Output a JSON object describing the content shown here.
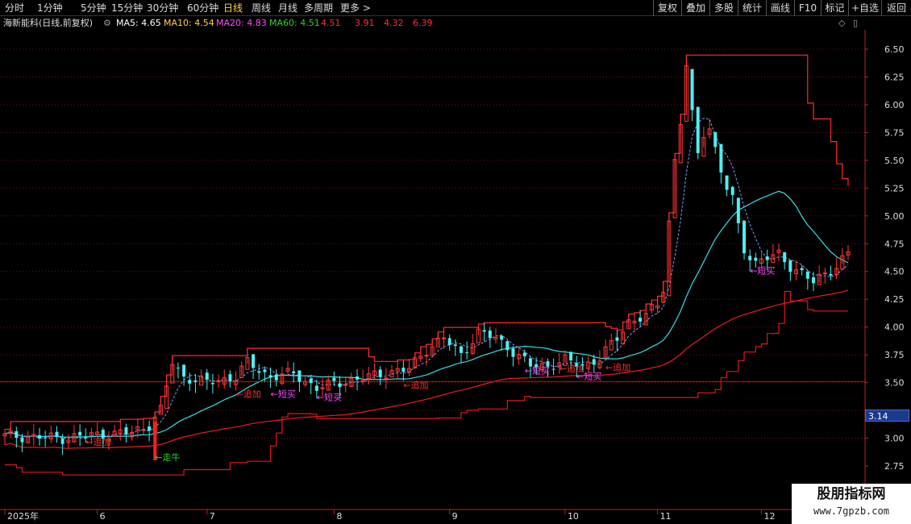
{
  "toolbar": {
    "tabs": [
      "分时",
      "1分钟",
      "5分钟",
      "15分钟",
      "30分钟",
      "60分钟",
      "日线",
      "周线",
      "月线",
      "多周期",
      "更多 >"
    ],
    "active_tab": "日线",
    "right_buttons": [
      "复权",
      "叠加",
      "多股",
      "统计",
      "画线",
      "F10",
      "标记",
      "+自选",
      "返回"
    ]
  },
  "info": {
    "title": "海新能科(日线,前复权)",
    "ma5": "MA5: 4.65",
    "ma10": "MA10: 4.54",
    "ma20": "MA20: 4.83",
    "ma60": "MA60: 4.51",
    "v1": "4.51",
    "v2": "3.91",
    "v3": "4.32",
    "v4": "6.39",
    "colors": {
      "ma5": "#ffffff",
      "ma10": "#ffd24a",
      "ma20": "#ff4cff",
      "ma60": "#2ad42a",
      "red": "#ff3030"
    }
  },
  "price_tag": "3.14",
  "watermark": {
    "title": "股朋指标网",
    "url": "www.7gpzb.com"
  },
  "chart_data": {
    "type": "candlestick",
    "y_ticks": [
      6.5,
      6.25,
      6.0,
      5.75,
      5.5,
      5.25,
      5.0,
      4.75,
      4.5,
      4.25,
      4.0,
      3.75,
      3.5,
      3.25,
      3.0,
      2.75
    ],
    "y_tick_labels": [
      "6.50",
      "6.25",
      "6.00",
      "5.75",
      "5.50",
      "5.25",
      "5.00",
      "4.75",
      "4.50",
      "4.25",
      "4.00",
      "3.75",
      "3.50",
      "",
      "3.00",
      "2.75"
    ],
    "ylim": [
      2.55,
      6.65
    ],
    "x_labels": [
      {
        "label": "2025年",
        "day": 0
      },
      {
        "label": "6",
        "day": 16
      },
      {
        "label": "7",
        "day": 35
      },
      {
        "label": "8",
        "day": 57
      },
      {
        "label": "9",
        "day": 77
      },
      {
        "label": "10",
        "day": 97
      },
      {
        "label": "11",
        "day": 113
      },
      {
        "label": "12",
        "day": 131
      }
    ],
    "day_count": 147,
    "annotations": [
      {
        "text": "←追加",
        "day": 14,
        "price": 2.94,
        "color": "#ff3030"
      },
      {
        "text": "←走牛",
        "day": 26,
        "price": 2.8,
        "color": "#2ad42a"
      },
      {
        "text": "←追加",
        "day": 40,
        "price": 3.37,
        "color": "#ff3030"
      },
      {
        "text": "←短买",
        "day": 46,
        "price": 3.37,
        "color": "#ff4cff"
      },
      {
        "text": "←短买",
        "day": 54,
        "price": 3.34,
        "color": "#ff4cff"
      },
      {
        "text": "←追加",
        "day": 69,
        "price": 3.45,
        "color": "#ff3030"
      },
      {
        "text": "←短买",
        "day": 90,
        "price": 3.58,
        "color": "#ff4cff"
      },
      {
        "text": "←追加",
        "day": 96,
        "price": 3.6,
        "color": "#ff3030"
      },
      {
        "text": "←短买",
        "day": 99,
        "price": 3.53,
        "color": "#ff4cff"
      },
      {
        "text": "←追加",
        "day": 104,
        "price": 3.61,
        "color": "#ff3030"
      },
      {
        "text": "←短买",
        "day": 129,
        "price": 4.48,
        "color": "#ff4cff"
      }
    ]
  }
}
